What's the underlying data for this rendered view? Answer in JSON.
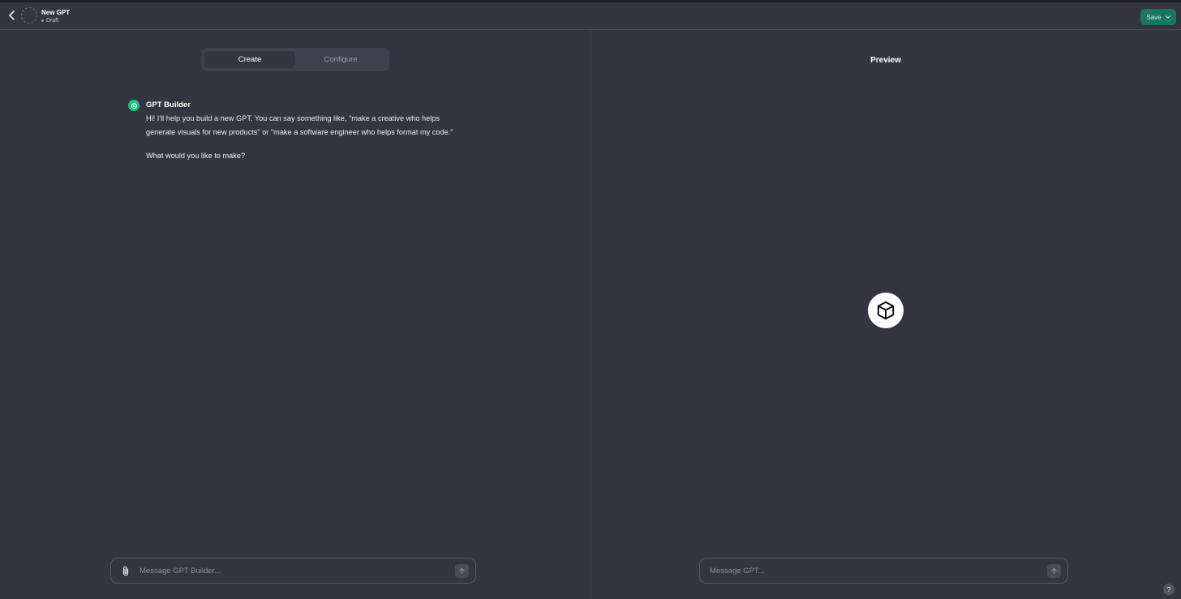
{
  "header": {
    "gpt_name": "New GPT",
    "status": "Draft",
    "save_label": "Save"
  },
  "tabs": [
    {
      "label": "Create",
      "active": true
    },
    {
      "label": "Configure",
      "active": false
    }
  ],
  "conversation": {
    "sender": "GPT Builder",
    "message_1": "Hi! I'll help you build a new GPT. You can say something like, \"make a creative who helps generate visuals for new products\" or \"make a software engineer who helps format my code.\"",
    "message_2": "What would you like to make?"
  },
  "builder_input": {
    "placeholder": "Message GPT Builder..."
  },
  "preview": {
    "title": "Preview",
    "input_placeholder": "Message GPT..."
  },
  "help": {
    "label": "?"
  },
  "colors": {
    "background": "#343541",
    "accent": "#19765f",
    "builder_icon": "#19c37d"
  }
}
